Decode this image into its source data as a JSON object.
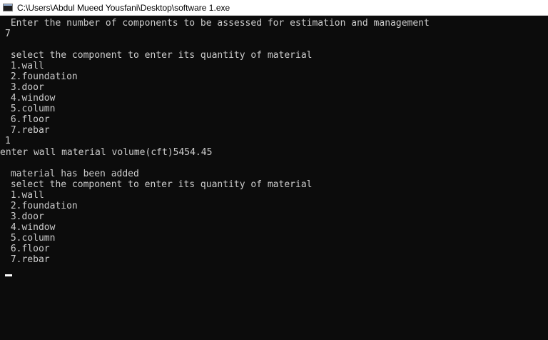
{
  "window": {
    "title": "C:\\Users\\Abdul Mueed Yousfani\\Desktop\\software 1.exe",
    "icon": "console-app-icon"
  },
  "console": {
    "lines": [
      " Enter the number of components to be assessed for estimation and management",
      "7",
      "",
      " select the component to enter its quantity of material",
      " 1.wall",
      " 2.foundation",
      " 3.door",
      " 4.window",
      " 5.column",
      " 6.floor",
      " 7.rebar",
      "1",
      "enter wall material volume(cft)5454.45",
      "",
      " material has been added",
      " select the component to enter its quantity of material",
      " 1.wall",
      " 2.foundation",
      " 3.door",
      " 4.window",
      " 5.column",
      " 6.floor",
      " 7.rebar"
    ]
  }
}
